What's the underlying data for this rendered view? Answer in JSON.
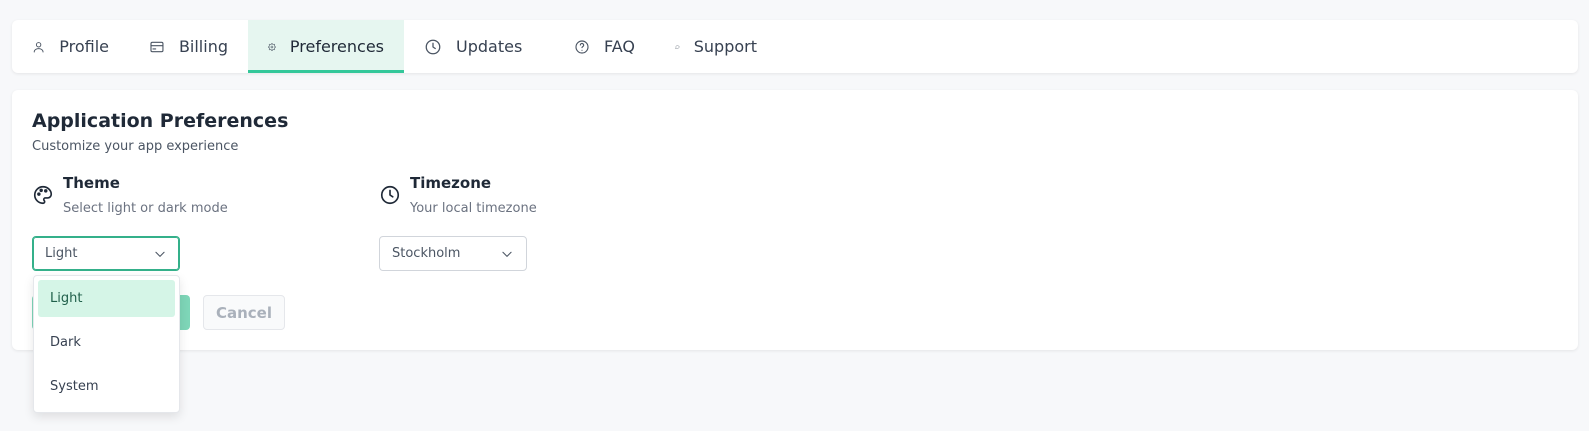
{
  "tabs": [
    {
      "label": "Profile",
      "icon": "user-icon",
      "active": false
    },
    {
      "label": "Billing",
      "icon": "credit-card-icon",
      "active": false
    },
    {
      "label": "Preferences",
      "icon": "gear-icon",
      "active": true
    },
    {
      "label": "Updates",
      "icon": "clock-icon",
      "active": false
    },
    {
      "label": "FAQ",
      "icon": "help-circle-icon",
      "active": false
    },
    {
      "label": "Support",
      "icon": "chat-bubble-icon",
      "active": false
    }
  ],
  "colors": {
    "accent": "#34c79a",
    "active_tab_bg": "#e6f6f0",
    "selected_option_bg": "#d5f5e7",
    "save_button_bg": "#7ed6b8"
  },
  "card": {
    "title": "Application Preferences",
    "subtitle": "Customize your app experience"
  },
  "theme": {
    "label": "Theme",
    "description": "Select light or dark mode",
    "icon": "palette-icon",
    "value": "Light",
    "options": [
      "Light",
      "Dark",
      "System"
    ],
    "selected_index": 0
  },
  "timezone": {
    "label": "Timezone",
    "description": "Your local timezone",
    "icon": "clock-icon",
    "value": "Stockholm"
  },
  "buttons": {
    "cancel_label": "Cancel"
  }
}
